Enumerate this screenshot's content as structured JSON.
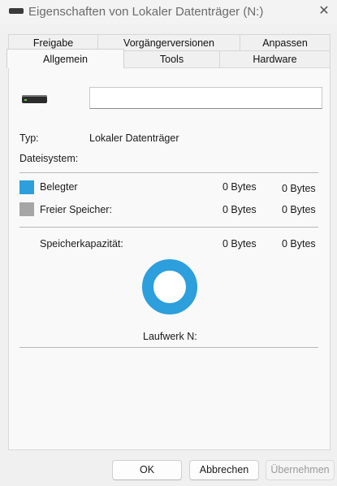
{
  "window": {
    "title": "Eigenschaften von Lokaler Datenträger (N:)",
    "close_glyph": "✕"
  },
  "tabs": {
    "row1": [
      "Freigabe",
      "Vorgängerversionen",
      "Anpassen"
    ],
    "row2": [
      "Allgemein",
      "Tools",
      "Hardware"
    ],
    "active": "Allgemein"
  },
  "general": {
    "name_value": "",
    "type_label": "Typ:",
    "type_value": "Lokaler Datenträger",
    "filesystem_label": "Dateisystem:",
    "filesystem_value": ""
  },
  "usage": {
    "used_label": "Belegter",
    "used_bytes": "0 Bytes",
    "used_size": "0 Bytes",
    "used_color": "#2c9fdc",
    "free_label": "Freier Speicher:",
    "free_bytes": "0 Bytes",
    "free_size": "0 Bytes",
    "free_color": "#a6a6a6",
    "capacity_label": "Speicherkapazität:",
    "capacity_bytes": "0 Bytes",
    "capacity_size": "0 Bytes",
    "drive_label": "Laufwerk N:"
  },
  "buttons": {
    "ok": "OK",
    "cancel": "Abbrechen",
    "apply": "Übernehmen"
  },
  "icons": {
    "title": "drive-icon",
    "close": "close-icon",
    "drive": "hard-drive-icon",
    "chart": "usage-donut-chart"
  }
}
